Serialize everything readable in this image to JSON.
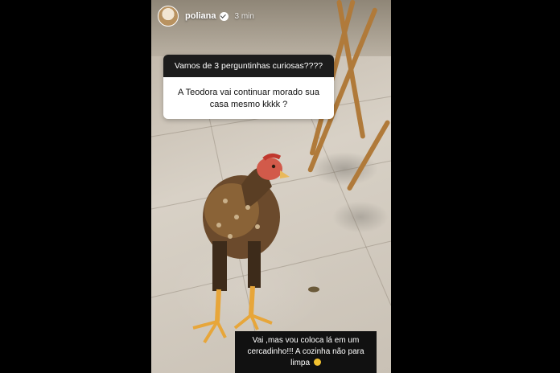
{
  "story": {
    "username": "poliana",
    "time": "3 min",
    "question_box": {
      "header": "Vamos de 3 perguntinhas curiosas????",
      "question": "A Teodora vai continuar morado  sua casa  mesmo kkkk ?"
    },
    "reply_text": "Vai ,mas vou coloca lá em um cercadinho!!!  A cozinha não para limpa",
    "icons": {
      "verified": "verified-badge-icon",
      "emoji": "emoji-face-icon"
    }
  },
  "colors": {
    "background": "#000000",
    "question_header": "#1c1c1c",
    "question_body": "#ffffff",
    "reply_background": "#111111"
  }
}
